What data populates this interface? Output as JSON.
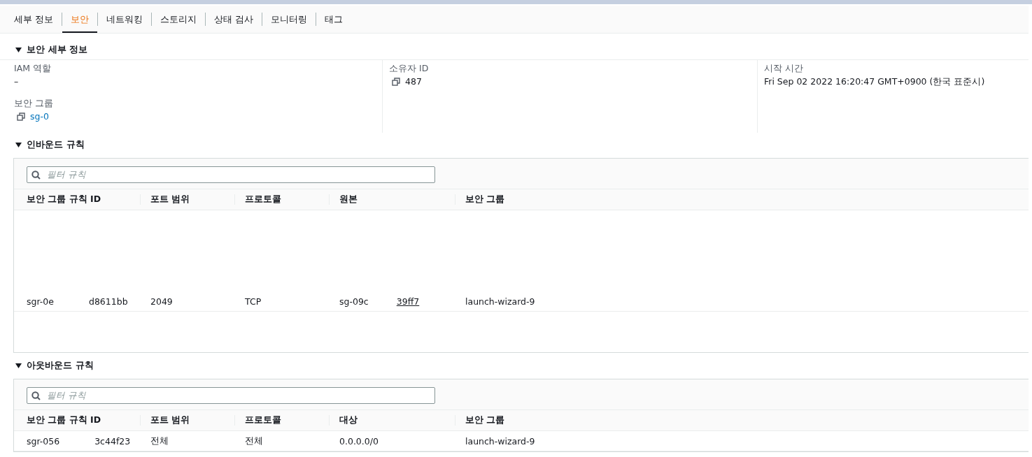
{
  "tabs": [
    {
      "label": "세부 정보",
      "selected": false
    },
    {
      "label": "보안",
      "selected": true
    },
    {
      "label": "네트워킹",
      "selected": false
    },
    {
      "label": "스토리지",
      "selected": false
    },
    {
      "label": "상태 검사",
      "selected": false
    },
    {
      "label": "모니터링",
      "selected": false
    },
    {
      "label": "태그",
      "selected": false
    }
  ],
  "security_details": {
    "title": "보안 세부 정보",
    "expanded": true,
    "columns": [
      [
        {
          "label": "IAM 역할",
          "value": "–",
          "kind": "text"
        },
        {
          "label": "보안 그룹",
          "value": "sg-0",
          "kind": "copy-link"
        }
      ],
      [
        {
          "label": "소유자 ID",
          "value": "487",
          "kind": "copy"
        }
      ],
      [
        {
          "label": "시작 시간",
          "value": "Fri Sep 02 2022 16:20:47 GMT+0900 (한국 표준시)",
          "kind": "text"
        }
      ]
    ]
  },
  "inbound_rules": {
    "title": "인바운드 규칙",
    "expanded": true,
    "filter": {
      "placeholder": "필터 규칙"
    },
    "columns": [
      "보안 그룹 규칙 ID",
      "포트 범위",
      "프로토콜",
      "원본",
      "보안 그룹"
    ],
    "rows": [
      {
        "cells": [
          [
            {
              "text": "sgr-0e",
              "link": false
            },
            {
              "text": "d8611bb",
              "link": false
            }
          ],
          [
            {
              "text": "2049",
              "link": false
            }
          ],
          [
            {
              "text": "TCP",
              "link": false
            }
          ],
          [
            {
              "text": "sg-09c",
              "link": false
            },
            {
              "text": "39ff7",
              "link": true
            }
          ],
          [
            {
              "text": "launch-wizard-9",
              "link": false
            }
          ]
        ]
      }
    ]
  },
  "outbound_rules": {
    "title": "아웃바운드 규칙",
    "expanded": true,
    "filter": {
      "placeholder": "필터 규칙"
    },
    "columns": [
      "보안 그룹 규칙 ID",
      "포트 범위",
      "프로토콜",
      "대상",
      "보안 그룹"
    ],
    "rows": [
      {
        "cells": [
          [
            {
              "text": "sgr-056",
              "link": false
            },
            {
              "text": "3c44f23",
              "link": false
            }
          ],
          [
            {
              "text": "전체",
              "link": false
            }
          ],
          [
            {
              "text": "전체",
              "link": false
            }
          ],
          [
            {
              "text": "0.0.0.0/0",
              "link": false
            }
          ],
          [
            {
              "text": "launch-wizard-9",
              "link": false
            }
          ]
        ]
      }
    ]
  }
}
